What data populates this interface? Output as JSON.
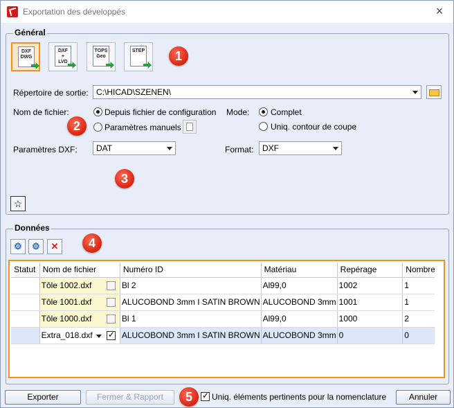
{
  "window": {
    "title": "Exportation des développés",
    "close_symbol": "×"
  },
  "general": {
    "group_title": "Général",
    "format_buttons": [
      {
        "label": "DXF DWG",
        "selected": true
      },
      {
        "label": "DXF + LVD",
        "selected": false
      },
      {
        "label": "TOPS Geo",
        "selected": false
      },
      {
        "label": "STEP",
        "selected": false
      }
    ],
    "output_dir_label": "Répertoire de sortie:",
    "output_dir_value": "C:\\HICAD\\SZENEN\\",
    "filename_label": "Nom de fichier:",
    "filename_options": [
      "Depuis fichier de configuration",
      "Paramètres manuels"
    ],
    "filename_selected": 0,
    "mode_label": "Mode:",
    "mode_options": [
      "Complet",
      "Uniq. contour de coupe"
    ],
    "mode_selected": 0,
    "dxf_params_label": "Paramètres DXF:",
    "dxf_params_value": "DAT",
    "format_label": "Format:",
    "format_value": "DXF",
    "favorite_symbol": "☆"
  },
  "data": {
    "group_title": "Données",
    "toolbar_symbols": [
      "⚙",
      "⚙",
      "✕"
    ],
    "columns": [
      "Statut",
      "Nom de fichier",
      "Numéro ID",
      "Matériau",
      "Repérage",
      "Nombre"
    ],
    "rows": [
      {
        "status": "",
        "filename": "Tôle  1002.dxf",
        "checked": false,
        "id": "Bl 2",
        "material": "Al99,0",
        "mark": "1002",
        "qty": "1"
      },
      {
        "status": "",
        "filename": "Tôle  1001.dxf",
        "checked": false,
        "id": "ALUCOBOND 3mm I SATIN BROWN",
        "material": "ALUCOBOND 3mm",
        "mark": "1001",
        "qty": "1"
      },
      {
        "status": "",
        "filename": "Tôle  1000.dxf",
        "checked": false,
        "id": "Bl 1",
        "material": "Al99,0",
        "mark": "1000",
        "qty": "2"
      },
      {
        "status": "",
        "filename": "Extra_018.dxf",
        "checked": true,
        "id": "ALUCOBOND 3mm I SATIN BROWN",
        "material": "ALUCOBOND 3mm",
        "mark": "0",
        "qty": "0"
      }
    ]
  },
  "footer": {
    "export_label": "Exporter",
    "close_report_label": "Fermer & Rapport",
    "bom_checkbox_label": "Uniq. éléments pertinents pour la nomenclature",
    "bom_checked": true,
    "cancel_label": "Annuler"
  },
  "callouts": [
    "1",
    "2",
    "3",
    "4",
    "5"
  ],
  "colors": {
    "accent_orange": "#f0931f",
    "callout_red": "#d8230f",
    "filename_cell_bg": "#fbf7cf",
    "selected_row_bg": "#dbe7f8"
  }
}
